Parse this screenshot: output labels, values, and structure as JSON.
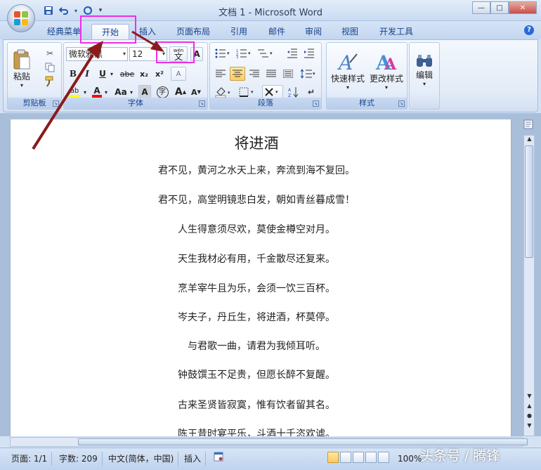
{
  "window": {
    "title": "文档 1 - Microsoft Word",
    "minimize": "—",
    "maximize": "□",
    "close": "✕"
  },
  "quick_access": {
    "save_icon": "save-icon",
    "undo_icon": "undo-icon",
    "redo_icon": "redo-icon",
    "customize": "▾"
  },
  "tabs": [
    {
      "label": "经典菜单",
      "active": false
    },
    {
      "label": "开始",
      "active": true
    },
    {
      "label": "插入",
      "active": false
    },
    {
      "label": "页面布局",
      "active": false
    },
    {
      "label": "引用",
      "active": false
    },
    {
      "label": "邮件",
      "active": false
    },
    {
      "label": "审阅",
      "active": false
    },
    {
      "label": "视图",
      "active": false
    },
    {
      "label": "开发工具",
      "active": false
    }
  ],
  "help": "?",
  "ribbon": {
    "clipboard": {
      "label": "剪贴板",
      "paste": "粘贴",
      "dropdown": "▾"
    },
    "font": {
      "label": "字体",
      "font_name": "微软雅黑",
      "font_size": "12",
      "phonetic_guide": "wén",
      "phonetic_char": "文",
      "char_border": "A",
      "bold": "B",
      "italic": "I",
      "underline": "U",
      "strikethrough": "abe",
      "subscript": "x₂",
      "superscript": "x²",
      "clear_format": "A",
      "highlight": "ab",
      "font_color": "A",
      "change_case": "Aa",
      "char_shading": "A",
      "enclose_char": "字",
      "grow_font": "A",
      "shrink_font": "A"
    },
    "paragraph": {
      "label": "段落"
    },
    "styles": {
      "label": "样式",
      "quick_styles": "快速样式",
      "change_styles": "更改样式"
    },
    "editing": {
      "label": "编辑"
    }
  },
  "document": {
    "title": "将进酒",
    "lines": [
      "君不见，黄河之水天上来，奔流到海不复回。",
      "君不见，高堂明镜悲白发，朝如青丝暮成雪！",
      "人生得意须尽欢，莫使金樽空对月。",
      "天生我材必有用，千金散尽还复来。",
      "烹羊宰牛且为乐，会须一饮三百杯。",
      "岑夫子，丹丘生，将进酒，杯莫停。",
      "与君歌一曲，请君为我倾耳听。",
      "钟鼓馔玉不足贵，但愿长醉不复醒。",
      "古来圣贤皆寂寞，惟有饮者留其名。",
      "陈王昔时宴平乐，斗酒十千恣欢谑。"
    ]
  },
  "status": {
    "page": "页面: 1/1",
    "words": "字数: 209",
    "language": "中文(简体，中国)",
    "insert_mode": "插入",
    "zoom": "100%"
  },
  "watermark": "头条号 / 腾锋",
  "colors": {
    "highlight_box": "#ee2ee8",
    "arrow": "#8b1a1a",
    "highlight_marker": "#ffff00",
    "font_color": "#ff0000"
  }
}
